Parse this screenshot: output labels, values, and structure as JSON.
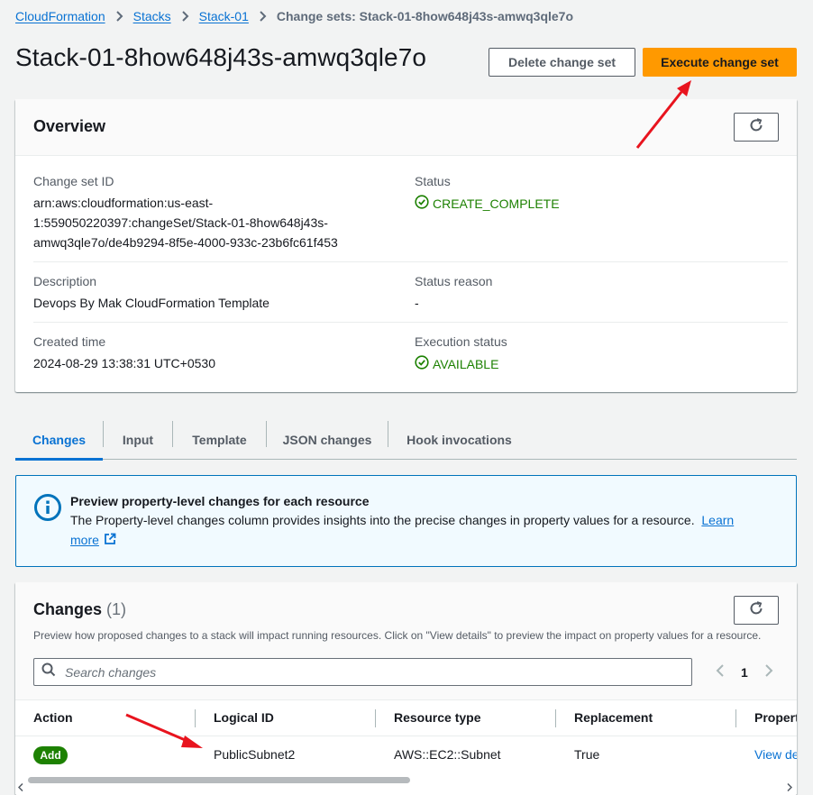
{
  "breadcrumb": {
    "items": [
      "CloudFormation",
      "Stacks",
      "Stack-01"
    ],
    "current": "Change sets: Stack-01-8how648j43s-amwq3qle7o"
  },
  "header": {
    "title": "Stack-01-8how648j43s-amwq3qle7o",
    "delete_label": "Delete change set",
    "execute_label": "Execute change set"
  },
  "overview": {
    "title": "Overview",
    "change_set_id_label": "Change set ID",
    "change_set_id_lines": [
      "arn:aws:cloudformation:us-east-",
      "1:559050220397:changeSet/Stack-01-8how648j43s-",
      "amwq3qle7o/de4b9294-8f5e-4000-933c-23b6fc61f453"
    ],
    "status_label": "Status",
    "status_value": "CREATE_COMPLETE",
    "description_label": "Description",
    "description_value": "Devops By Mak CloudFormation Template",
    "status_reason_label": "Status reason",
    "status_reason_value": "-",
    "created_label": "Created time",
    "created_value": "2024-08-29 13:38:31 UTC+0530",
    "execution_label": "Execution status",
    "execution_value": "AVAILABLE"
  },
  "tabs": [
    "Changes",
    "Input",
    "Template",
    "JSON changes",
    "Hook invocations"
  ],
  "alert": {
    "title": "Preview property-level changes for each resource",
    "text": "The Property-level changes column provides insights into the precise changes in property values for a resource.",
    "link_part1": "Learn",
    "link_part2": "more"
  },
  "changes": {
    "title": "Changes",
    "count": "(1)",
    "description": "Preview how proposed changes to a stack will impact running resources. Click on \"View details\" to preview the impact on property values for a resource.",
    "search_placeholder": "Search changes",
    "page": "1",
    "columns": [
      "Action",
      "Logical ID",
      "Resource type",
      "Replacement",
      "Propert"
    ],
    "row": {
      "action": "Add",
      "logical_id": "PublicSubnet2",
      "resource_type": "AWS::EC2::Subnet",
      "replacement": "True",
      "details_link": "View de"
    }
  },
  "colors": {
    "link": "#0972d3",
    "primary": "#ff9900",
    "success": "#1d8102",
    "annotation_arrow": "#e8141e"
  },
  "icons": [
    "chevron-right-icon",
    "refresh-icon",
    "success-check-icon",
    "info-icon",
    "external-link-icon",
    "search-icon",
    "chevron-left-icon"
  ]
}
